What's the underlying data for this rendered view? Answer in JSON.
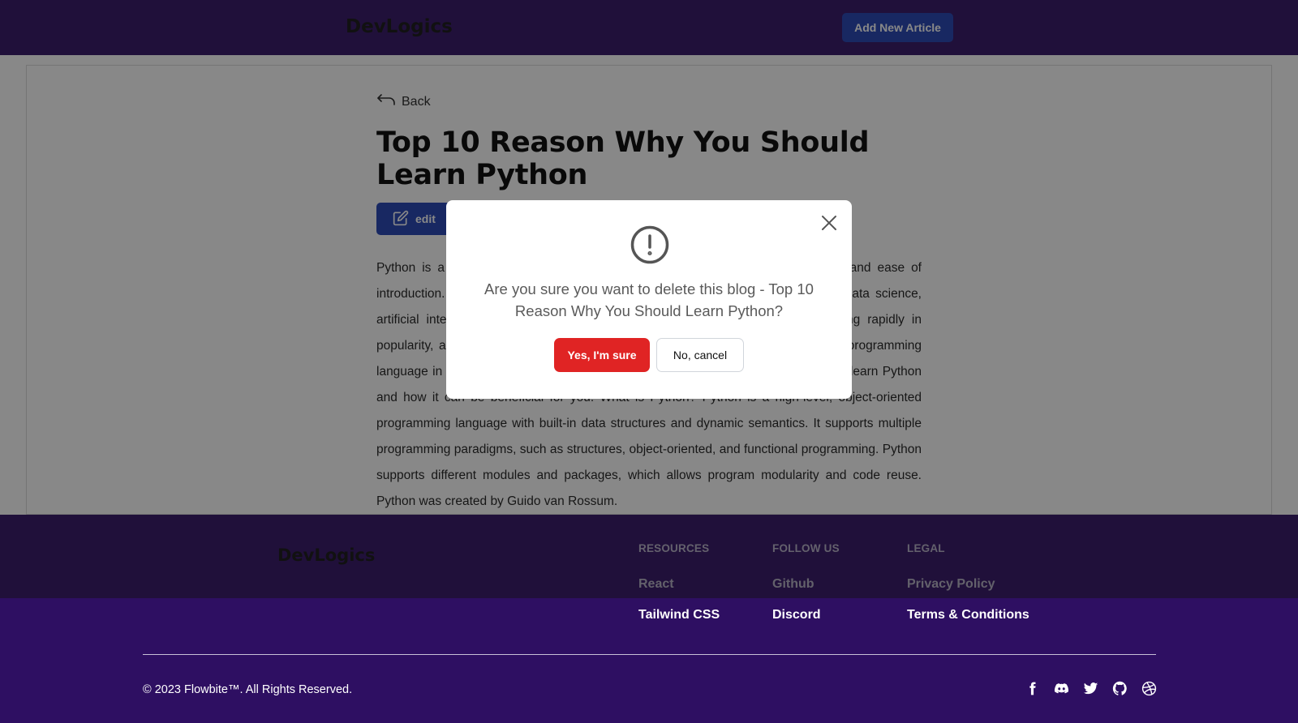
{
  "header": {
    "brand": "DevLogics",
    "add_article_label": "Add New Article"
  },
  "article": {
    "back_label": "Back",
    "title": "Top 10 Reason Why You Should Learn Python",
    "edit_label": "edit",
    "body": "Python is a popular programming language that is known for its simple syntax and ease of introduction. It is widely used in a variety of fields, including web development, data science, artificial intelligent, machine learning, and scientific computing. Python is growing rapidly in popularity, and in recent years, Python has surpassed Java as the most popular programming language in the world. In this blog, we explore the top ten reasons why you should learn Python and how it can be beneficial for you. What is Python? Python is a high-level, object-oriented programming language with built-in data structures and dynamic semantics. It supports multiple programming paradigms, such as structures, object-oriented, and functional programming. Python supports different modules and packages, which allows program modularity and code reuse. Python was created by Guido van Rossum."
  },
  "modal": {
    "message": "Are you sure you want to delete this blog - Top 10 Reason Why You Should Learn Python?",
    "confirm_label": "Yes, I'm sure",
    "cancel_label": "No, cancel"
  },
  "footer": {
    "brand": "DevLogics",
    "columns": [
      {
        "heading": "RESOURCES",
        "links": [
          "React",
          "Tailwind CSS"
        ]
      },
      {
        "heading": "FOLLOW US",
        "links": [
          "Github",
          "Discord"
        ]
      },
      {
        "heading": "LEGAL",
        "links": [
          "Privacy Policy",
          "Terms & Conditions"
        ]
      }
    ],
    "copyright": "© 2023 Flowbite™. All Rights Reserved.",
    "socials": [
      "facebook-icon",
      "discord-icon",
      "twitter-icon",
      "github-icon",
      "dribbble-icon"
    ]
  },
  "colors": {
    "header_bg": "#2e0f62",
    "primary_button": "#1e3fb3",
    "danger_button": "#e02424"
  }
}
